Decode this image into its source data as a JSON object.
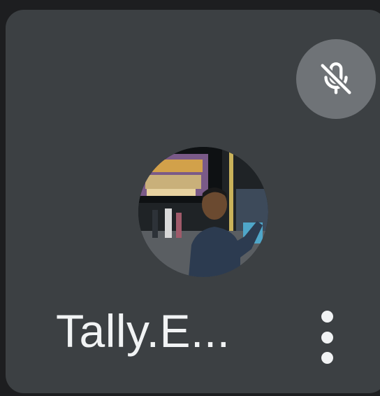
{
  "participant": {
    "name": "Tally.E...",
    "avatar": "participant-photo",
    "microphone": "muted"
  },
  "icons": {
    "mute_status": "mic-off-icon",
    "menu": "more-vertical-icon"
  },
  "colors": {
    "tile_background": "#3c4043",
    "mute_badge": "#6f7377",
    "text": "#f1f3f4"
  }
}
